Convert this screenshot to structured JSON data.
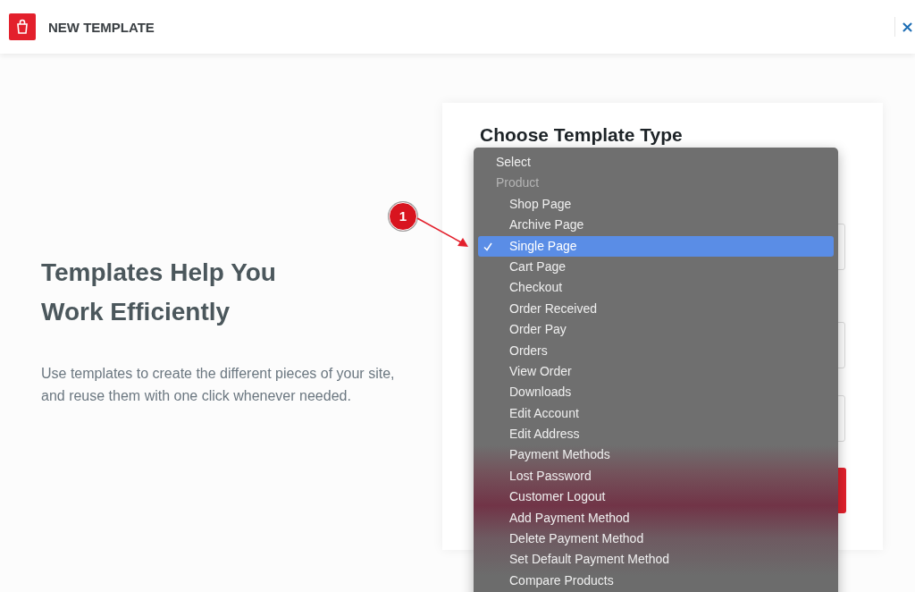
{
  "header": {
    "title": "NEW TEMPLATE"
  },
  "intro": {
    "heading": "Templates Help You Work Efficiently",
    "text": "Use templates to create the different pieces of your site, and reuse them with one click whenever needed."
  },
  "card": {
    "heading": "Choose Template Type"
  },
  "menu": {
    "items": [
      {
        "kind": "option",
        "label": "Select",
        "selected": false
      },
      {
        "kind": "group",
        "label": "Product",
        "options": [
          {
            "label": "Shop Page",
            "selected": false
          },
          {
            "label": "Archive Page",
            "selected": false
          },
          {
            "label": "Single Page",
            "selected": true
          },
          {
            "label": "Cart Page",
            "selected": false
          },
          {
            "label": "Checkout",
            "selected": false
          },
          {
            "label": "Order Received",
            "selected": false
          },
          {
            "label": "Order Pay",
            "selected": false
          },
          {
            "label": "Orders",
            "selected": false
          },
          {
            "label": "View Order",
            "selected": false
          },
          {
            "label": "Downloads",
            "selected": false
          },
          {
            "label": "Edit Account",
            "selected": false
          },
          {
            "label": "Edit Address",
            "selected": false
          },
          {
            "label": "Payment Methods",
            "selected": false
          },
          {
            "label": "Lost Password",
            "selected": false
          },
          {
            "label": "Customer Logout",
            "selected": false
          },
          {
            "label": "Add Payment Method",
            "selected": false
          },
          {
            "label": "Delete Payment Method",
            "selected": false
          },
          {
            "label": "Set Default Payment Method",
            "selected": false
          },
          {
            "label": "Compare Products",
            "selected": false
          }
        ]
      }
    ]
  },
  "annotation": {
    "number": "1"
  }
}
